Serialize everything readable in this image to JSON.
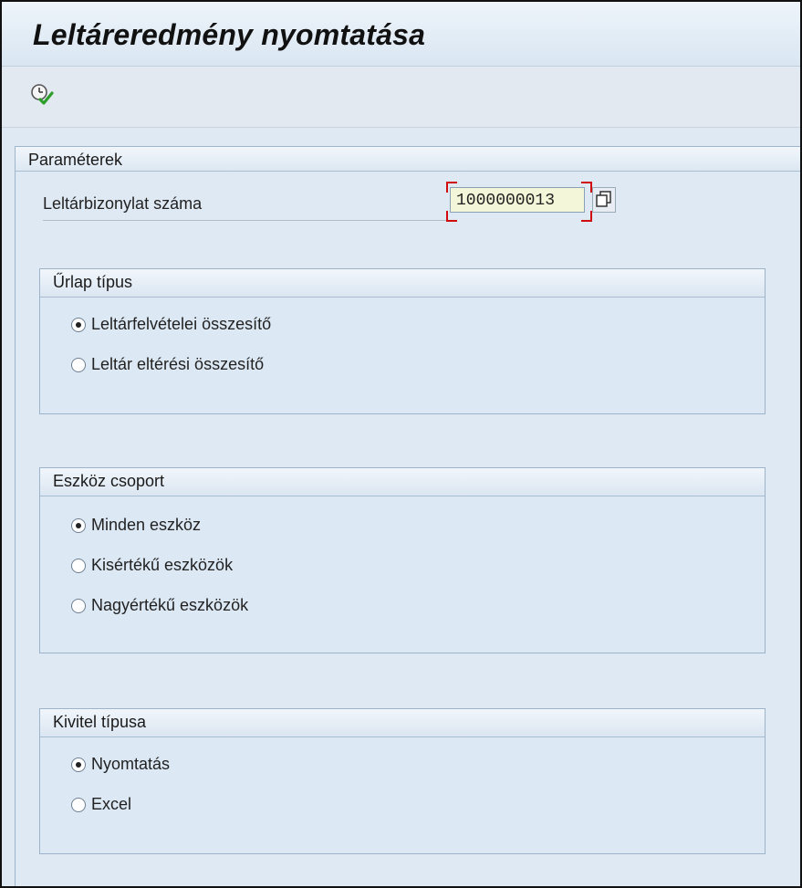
{
  "window": {
    "title": "Leltáreredmény nyomtatása"
  },
  "toolbar": {
    "execute_icon": "execute-clock-check-icon"
  },
  "parameters": {
    "section_title": "Paraméterek",
    "doc_number_label": "Leltárbizonylat száma",
    "doc_number_value": "1000000013",
    "multiple_selection_icon": "multiple-selection-icon"
  },
  "form_type": {
    "title": "Űrlap típus",
    "options": [
      {
        "label": "Leltárfelvételei összesítő",
        "selected": true
      },
      {
        "label": "Leltár eltérési összesítő",
        "selected": false
      }
    ]
  },
  "asset_group": {
    "title": "Eszköz csoport",
    "options": [
      {
        "label": "Minden eszköz",
        "selected": true
      },
      {
        "label": "Kisértékű eszközök",
        "selected": false
      },
      {
        "label": "Nagyértékű eszközök",
        "selected": false
      }
    ]
  },
  "output_type": {
    "title": "Kivitel típusa",
    "options": [
      {
        "label": "Nyomtatás",
        "selected": true
      },
      {
        "label": "Excel",
        "selected": false
      }
    ]
  },
  "colors": {
    "background": "#dfe9f4",
    "input_bg": "#f3f6d8",
    "focus": "#d10b0b"
  }
}
